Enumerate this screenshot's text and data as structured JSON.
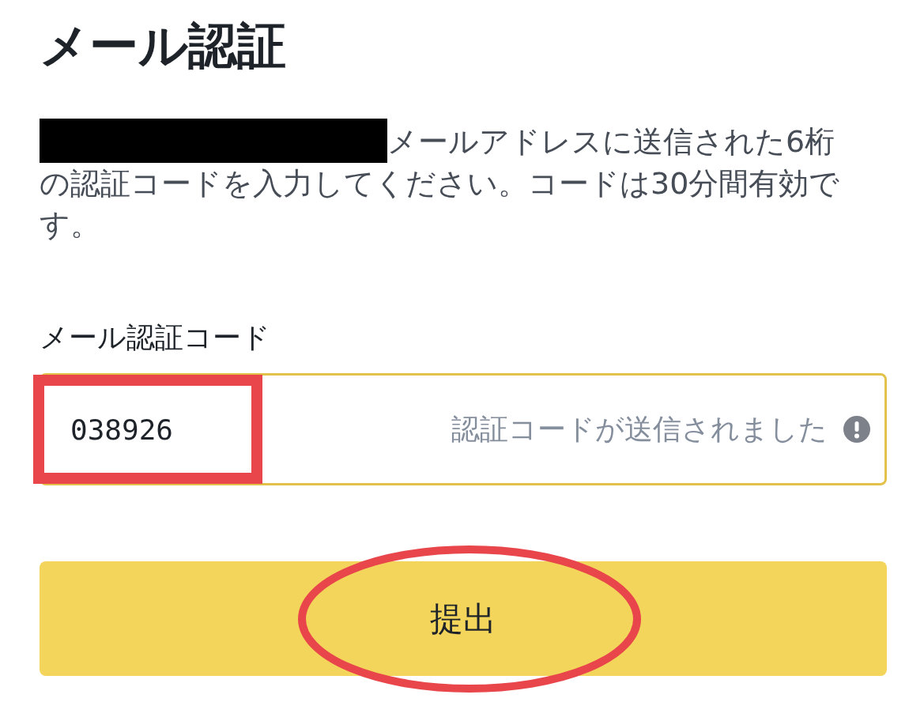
{
  "title": "メール認証",
  "description": {
    "redacted_prefix": true,
    "text": "メールアドレスに送信された6桁の認証コードを入力してください。コードは30分間有効です。"
  },
  "code_field": {
    "label": "メール認証コード",
    "value": "038926",
    "status_message": "認証コードが送信されました",
    "highlighted": true
  },
  "submit_button": {
    "label": "提出",
    "highlighted": true
  }
}
